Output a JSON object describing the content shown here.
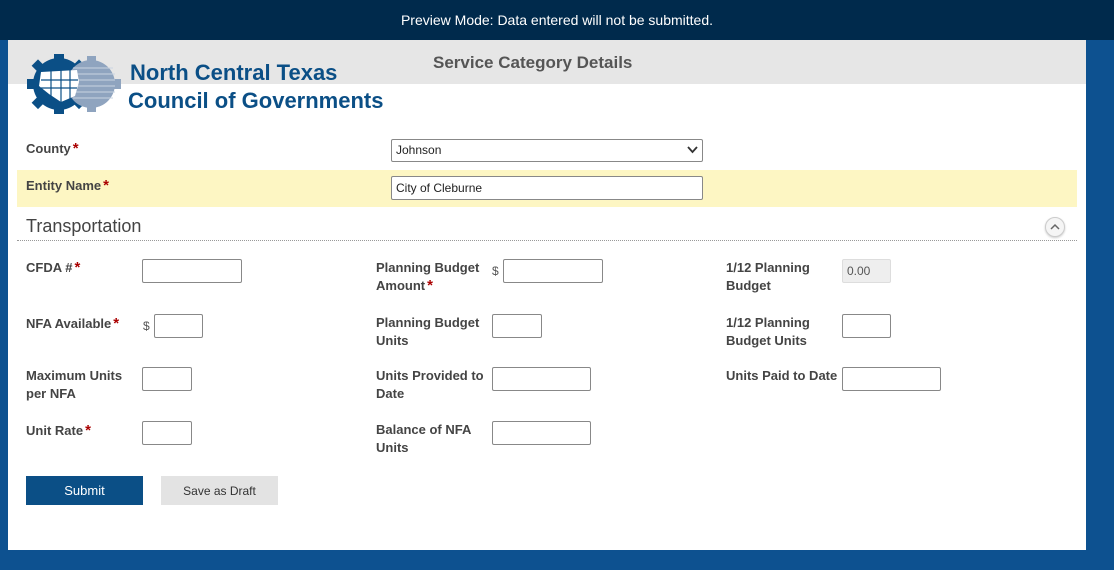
{
  "preview_banner": "Preview Mode: Data entered will not be submitted.",
  "page_title": "Service Category Details",
  "logo": {
    "line1": "North Central Texas",
    "line2": "Council of Governments"
  },
  "county": {
    "label": "County",
    "value": "Johnson"
  },
  "entity": {
    "label": "Entity Name",
    "value": "City of Cleburne"
  },
  "section": {
    "title": "Transportation"
  },
  "fields": {
    "cfda": {
      "label": "CFDA #",
      "value": ""
    },
    "planning_budget_amount": {
      "label_line1": "Planning Budget",
      "label_line2": "Amount",
      "value": ""
    },
    "twelfth_planning_budget": {
      "label_line1": "1/12 Planning",
      "label_line2": "Budget",
      "value": "0.00"
    },
    "nfa_available": {
      "label": "NFA Available",
      "value": ""
    },
    "planning_budget_units": {
      "label_line1": "Planning Budget",
      "label_line2": "Units",
      "value": ""
    },
    "twelfth_planning_budget_units": {
      "label_line1": "1/12 Planning",
      "label_line2": "Budget Units",
      "value": ""
    },
    "max_units_per_nfa": {
      "label_line1": "Maximum Units",
      "label_line2": "per NFA",
      "value": ""
    },
    "units_provided": {
      "label_line1": "Units Provided to",
      "label_line2": "Date",
      "value": ""
    },
    "units_paid": {
      "label": "Units Paid to Date",
      "value": ""
    },
    "unit_rate": {
      "label": "Unit Rate",
      "value": ""
    },
    "balance_nfa_units": {
      "label_line1": "Balance of NFA",
      "label_line2": "Units",
      "value": ""
    }
  },
  "currency_symbol": "$",
  "required_marker": "*",
  "buttons": {
    "submit": "Submit",
    "save_draft": "Save as Draft"
  },
  "colors": {
    "brand": "#0b4f86",
    "top_bar": "#002a4c",
    "highlight": "#fdf6c3"
  },
  "icons": {
    "collapse": "chevron-up-icon",
    "select": "chevron-down-icon",
    "logo": "gear-map-logo"
  }
}
